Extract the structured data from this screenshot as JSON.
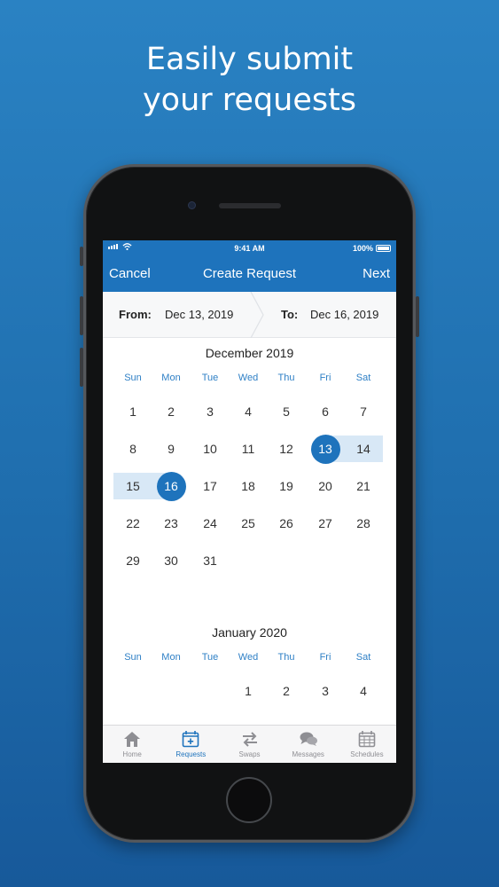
{
  "headline": {
    "line1": "Easily submit",
    "line2": "your requests"
  },
  "status_bar": {
    "time": "9:41 AM",
    "battery": "100%"
  },
  "nav": {
    "cancel": "Cancel",
    "title": "Create Request",
    "next": "Next"
  },
  "range": {
    "from_label": "From:",
    "from_value": "Dec 13, 2019",
    "to_label": "To:",
    "to_value": "Dec 16, 2019"
  },
  "weekdays": [
    "Sun",
    "Mon",
    "Tue",
    "Wed",
    "Thu",
    "Fri",
    "Sat"
  ],
  "months": [
    {
      "title": "December 2019",
      "weeks": [
        [
          "1",
          "2",
          "3",
          "4",
          "5",
          "6",
          "7"
        ],
        [
          "8",
          "9",
          "10",
          "11",
          "12",
          "13",
          "14"
        ],
        [
          "15",
          "16",
          "17",
          "18",
          "19",
          "20",
          "21"
        ],
        [
          "22",
          "23",
          "24",
          "25",
          "26",
          "27",
          "28"
        ],
        [
          "29",
          "30",
          "31",
          "",
          "",
          "",
          ""
        ]
      ],
      "selected_start": "13",
      "selected_end": "16"
    },
    {
      "title": "January 2020",
      "weeks": [
        [
          "",
          "",
          "",
          "1",
          "2",
          "3",
          "4"
        ]
      ]
    }
  ],
  "tabs": [
    {
      "label": "Home",
      "icon": "home-icon",
      "active": false
    },
    {
      "label": "Requests",
      "icon": "calendar-plus-icon",
      "active": true
    },
    {
      "label": "Swaps",
      "icon": "swap-arrows-icon",
      "active": false
    },
    {
      "label": "Messages",
      "icon": "chat-bubbles-icon",
      "active": false
    },
    {
      "label": "Schedules",
      "icon": "calendar-grid-icon",
      "active": false
    }
  ],
  "colors": {
    "brand": "#1e73bc",
    "range_highlight": "#d8e8f6",
    "weekday_text": "#2f80c6"
  }
}
